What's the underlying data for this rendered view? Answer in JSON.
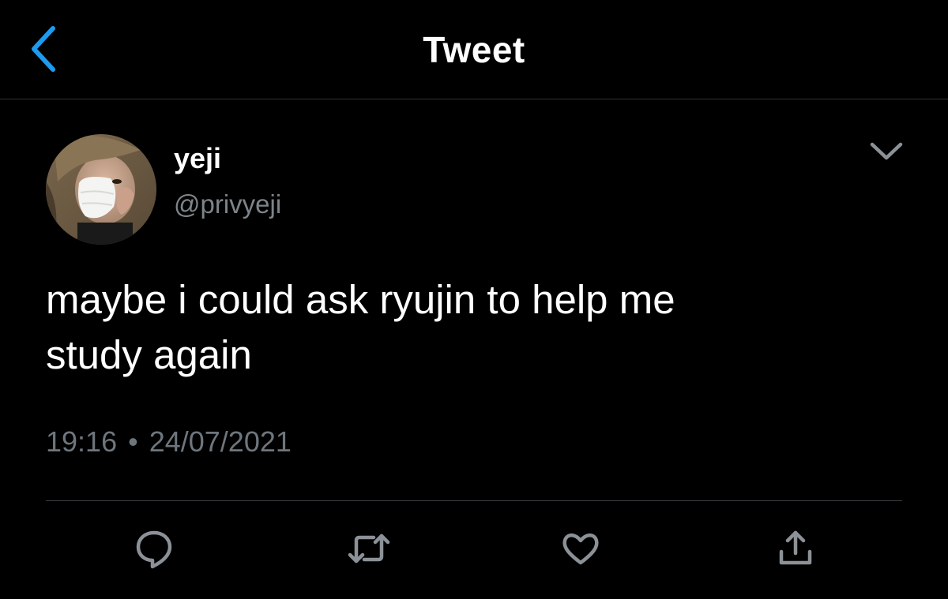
{
  "nav": {
    "title": "Tweet",
    "back_icon": "chevron-left-icon"
  },
  "author": {
    "display_name": "yeji",
    "handle": "@privyeji",
    "avatar": "profile-photo"
  },
  "tweet": {
    "text_lines": [
      "maybe i could ask ryujin to help me",
      "study again"
    ],
    "time": "19:16",
    "separator": "•",
    "date": "24/07/2021"
  },
  "actions": [
    {
      "name": "reply",
      "icon": "reply-icon"
    },
    {
      "name": "retweet",
      "icon": "retweet-icon"
    },
    {
      "name": "like",
      "icon": "heart-icon"
    },
    {
      "name": "share",
      "icon": "share-icon"
    }
  ],
  "colors": {
    "background": "#000000",
    "accent": "#1d9bf0",
    "muted_text": "#6e767d",
    "icon_gray": "#8b9196",
    "divider": "#2f3336"
  }
}
